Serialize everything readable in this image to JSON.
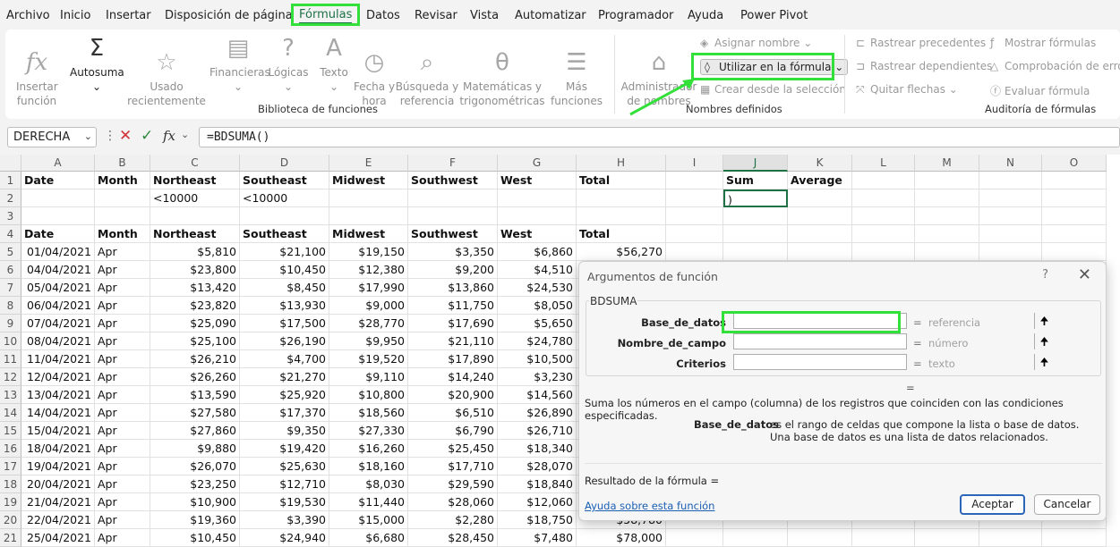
{
  "menu": {
    "items": [
      "Archivo",
      "Inicio",
      "Insertar",
      "Disposición de página",
      "Fórmulas",
      "Datos",
      "Revisar",
      "Vista",
      "Automatizar",
      "Programador",
      "Ayuda",
      "Power Pivot"
    ]
  },
  "ribbon": {
    "insert_function": "Insertar\nfunción",
    "autosum": "Autosuma",
    "recent": "Usado\nrecientemente",
    "financial": "Financieras",
    "logical": "Lógicas",
    "text": "Texto",
    "datetime": "Fecha y\nhora",
    "lookup": "Búsqueda y\nreferencia",
    "math": "Matemáticas y\ntrigonométricas",
    "more": "Más\nfunciones",
    "group_library": "Biblioteca de funciones",
    "name_manager": "Administrador\nde nombres",
    "assign_name": "Asignar nombre",
    "use_in_formula": "Utilizar en la fórmula",
    "create_from_selection": "Crear desde la selección",
    "group_names": "Nombres definidos",
    "trace_precedents": "Rastrear precedentes",
    "trace_dependents": "Rastrear dependientes",
    "remove_arrows": "Quitar flechas",
    "show_formulas": "Mostrar fórmulas",
    "error_checking": "Comprobación de errores",
    "evaluate_formula": "Evaluar fórmula",
    "group_audit": "Auditoría de fórmulas"
  },
  "formula_bar": {
    "name_box": "DERECHA",
    "formula": "=BDSUMA()"
  },
  "columns": [
    "A",
    "B",
    "C",
    "D",
    "E",
    "F",
    "G",
    "H",
    "I",
    "J",
    "K",
    "L",
    "M",
    "N",
    "O"
  ],
  "rows": [
    [
      "Date",
      "Month",
      "Northeast",
      "Southeast",
      "Midwest",
      "Southwest",
      "West",
      "Total",
      "",
      "Sum",
      "Average",
      "",
      "",
      "",
      ""
    ],
    [
      "",
      "",
      "<10000",
      "<10000",
      "",
      "",
      "",
      "",
      "",
      ")",
      "",
      "",
      "",
      "",
      ""
    ],
    [
      "",
      "",
      "",
      "",
      "",
      "",
      "",
      "",
      "",
      "",
      "",
      "",
      "",
      "",
      ""
    ],
    [
      "Date",
      "Month",
      "Northeast",
      "Southeast",
      "Midwest",
      "Southwest",
      "West",
      "Total",
      "",
      "",
      "",
      "",
      "",
      "",
      ""
    ],
    [
      "01/04/2021",
      "Apr",
      "$5,810",
      "$21,100",
      "$19,150",
      "$3,350",
      "$6,860",
      "$56,270",
      "",
      "",
      "",
      "",
      "",
      "",
      ""
    ],
    [
      "04/04/2021",
      "Apr",
      "$23,800",
      "$10,450",
      "$12,380",
      "$9,200",
      "$4,510",
      "",
      "",
      "",
      "",
      "",
      "",
      "",
      ""
    ],
    [
      "05/04/2021",
      "Apr",
      "$13,420",
      "$8,450",
      "$17,990",
      "$13,860",
      "$24,530",
      "",
      "",
      "",
      "",
      "",
      "",
      "",
      ""
    ],
    [
      "06/04/2021",
      "Apr",
      "$23,820",
      "$13,930",
      "$9,000",
      "$11,750",
      "$8,050",
      "",
      "",
      "",
      "",
      "",
      "",
      "",
      ""
    ],
    [
      "07/04/2021",
      "Apr",
      "$25,090",
      "$17,500",
      "$28,770",
      "$17,690",
      "$5,650",
      "",
      "",
      "",
      "",
      "",
      "",
      "",
      ""
    ],
    [
      "08/04/2021",
      "Apr",
      "$25,100",
      "$26,190",
      "$9,950",
      "$21,110",
      "$24,780",
      "",
      "",
      "",
      "",
      "",
      "",
      "",
      ""
    ],
    [
      "11/04/2021",
      "Apr",
      "$26,210",
      "$4,700",
      "$19,520",
      "$17,890",
      "$10,500",
      "",
      "",
      "",
      "",
      "",
      "",
      "",
      ""
    ],
    [
      "12/04/2021",
      "Apr",
      "$26,260",
      "$21,270",
      "$9,110",
      "$14,240",
      "$3,230",
      "",
      "",
      "",
      "",
      "",
      "",
      "",
      ""
    ],
    [
      "13/04/2021",
      "Apr",
      "$13,590",
      "$25,920",
      "$10,800",
      "$20,900",
      "$14,560",
      "",
      "",
      "",
      "",
      "",
      "",
      "",
      ""
    ],
    [
      "14/04/2021",
      "Apr",
      "$27,580",
      "$17,370",
      "$18,560",
      "$6,510",
      "$26,890",
      "",
      "",
      "",
      "",
      "",
      "",
      "",
      ""
    ],
    [
      "15/04/2021",
      "Apr",
      "$27,860",
      "$9,350",
      "$27,330",
      "$6,790",
      "$26,710",
      "",
      "",
      "",
      "",
      "",
      "",
      "",
      ""
    ],
    [
      "18/04/2021",
      "Apr",
      "$9,880",
      "$19,420",
      "$16,260",
      "$25,450",
      "$18,340",
      "",
      "",
      "",
      "",
      "",
      "",
      "",
      ""
    ],
    [
      "19/04/2021",
      "Apr",
      "$26,070",
      "$25,630",
      "$18,160",
      "$17,710",
      "$28,070",
      "",
      "",
      "",
      "",
      "",
      "",
      "",
      ""
    ],
    [
      "20/04/2021",
      "Apr",
      "$23,250",
      "$12,710",
      "$8,030",
      "$29,590",
      "$18,840",
      "",
      "",
      "",
      "",
      "",
      "",
      "",
      ""
    ],
    [
      "21/04/2021",
      "Apr",
      "$10,900",
      "$19,530",
      "$11,440",
      "$28,060",
      "$12,060",
      "",
      "",
      "",
      "",
      "",
      "",
      "",
      ""
    ],
    [
      "22/04/2021",
      "Apr",
      "$19,360",
      "$3,390",
      "$15,000",
      "$2,280",
      "$18,750",
      "$58,780",
      "",
      "",
      "",
      "",
      "",
      "",
      ""
    ],
    [
      "25/04/2021",
      "Apr",
      "$10,450",
      "$24,940",
      "$6,680",
      "$28,450",
      "$7,480",
      "$78,000",
      "",
      "",
      "",
      "",
      "",
      "",
      ""
    ]
  ],
  "dialog": {
    "title": "Argumentos de función",
    "help_mark": "?",
    "close": "✕",
    "function_name": "BDSUMA",
    "args": [
      {
        "label": "Base_de_datos",
        "eq": "=",
        "hint": "referencia"
      },
      {
        "label": "Nombre_de_campo",
        "eq": "=",
        "hint": "número"
      },
      {
        "label": "Criterios",
        "eq": "=",
        "hint": "texto"
      }
    ],
    "result_eq": "=",
    "description": "Suma los números en el campo (columna) de los registros que coinciden con las condiciones especificadas.",
    "arg_desc_label": "Base_de_datos",
    "arg_desc_text": "es el rango de celdas que compone la lista o base de datos. Una base de datos es una lista de datos relacionados.",
    "result_label": "Resultado de la fórmula =",
    "help_link": "Ayuda sobre esta función",
    "ok": "Aceptar",
    "cancel": "Cancelar"
  }
}
